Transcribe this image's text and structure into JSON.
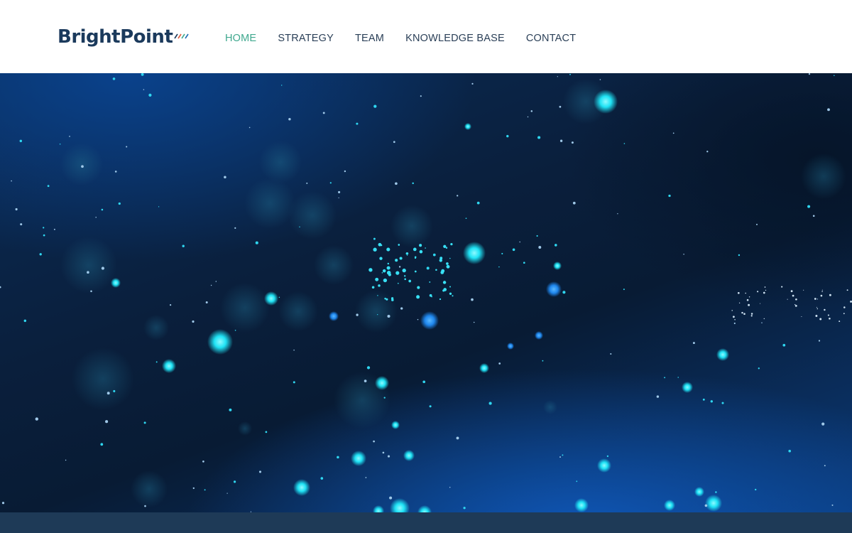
{
  "brand": {
    "name": "BrightPoint",
    "mark_colors": [
      "#1b3a5c",
      "#e05a3a",
      "#3fa88e",
      "#1b6fb5"
    ]
  },
  "nav": {
    "items": [
      {
        "label": "HOME",
        "active": true
      },
      {
        "label": "STRATEGY",
        "active": false
      },
      {
        "label": "TEAM",
        "active": false
      },
      {
        "label": "KNOWLEDGE BASE",
        "active": false
      },
      {
        "label": "CONTACT",
        "active": false
      }
    ]
  },
  "colors": {
    "nav_text": "#2a3f57",
    "nav_active": "#3fa88e",
    "hero_dark": "#0a1f3c",
    "particle_glow": "#1fe3f5",
    "footer_band": "#1e3a57"
  },
  "hero": {
    "image_description_icon": "particle-bokeh-background"
  }
}
